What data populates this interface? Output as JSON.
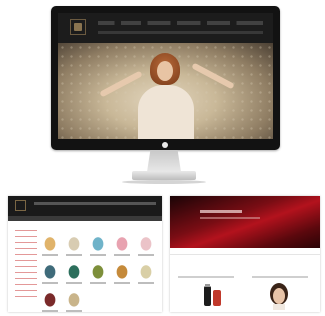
{
  "monitor": {
    "hero_script_text": "",
    "colors": {
      "frame": "#121212",
      "header": "#1c1c1c",
      "accent": "#8c3b3b"
    }
  },
  "left_page": {
    "title_script": "",
    "products": [
      {
        "name": "",
        "color": "#e0b36a",
        "row": 1,
        "col": 1
      },
      {
        "name": "",
        "color": "#d8ccb2",
        "row": 1,
        "col": 2
      },
      {
        "name": "",
        "color": "#6fb3c9",
        "row": 1,
        "col": 3
      },
      {
        "name": "",
        "color": "#e8a2b0",
        "row": 1,
        "col": 4
      },
      {
        "name": "",
        "color": "#ebc3c8",
        "row": 1,
        "col": 5
      },
      {
        "name": "",
        "color": "#3f6b7a",
        "row": 2,
        "col": 1
      },
      {
        "name": "",
        "color": "#2c6f5c",
        "row": 2,
        "col": 2
      },
      {
        "name": "",
        "color": "#7d8f3a",
        "row": 2,
        "col": 3
      },
      {
        "name": "",
        "color": "#c58a3a",
        "row": 2,
        "col": 4
      },
      {
        "name": "",
        "color": "#d9cfa6",
        "row": 2,
        "col": 5
      },
      {
        "name": "",
        "color": "#7a2a2a",
        "row": 3,
        "col": 1
      },
      {
        "name": "",
        "color": "#c9b48a",
        "row": 3,
        "col": 2
      }
    ]
  },
  "right_page": {
    "banner_color": "#b3121d",
    "script_left": "",
    "script_right": ""
  }
}
